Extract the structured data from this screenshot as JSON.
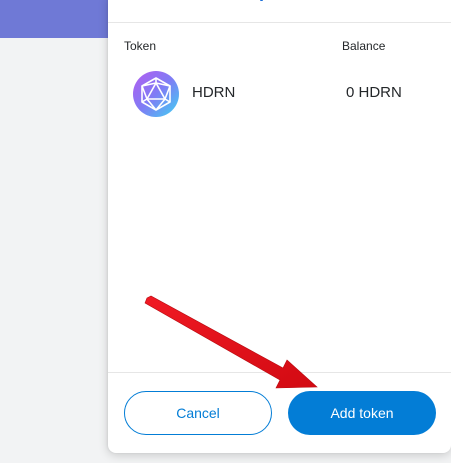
{
  "table": {
    "header_token": "Token",
    "header_balance": "Balance"
  },
  "token": {
    "name": "HDRN",
    "balance": "0 HDRN",
    "icon": "hdrn-icosahedron-icon"
  },
  "buttons": {
    "cancel_label": "Cancel",
    "add_label": "Add token"
  },
  "colors": {
    "accent": "#037dd6",
    "banner": "#6f79d6",
    "annotation_arrow": "#e8141e"
  }
}
